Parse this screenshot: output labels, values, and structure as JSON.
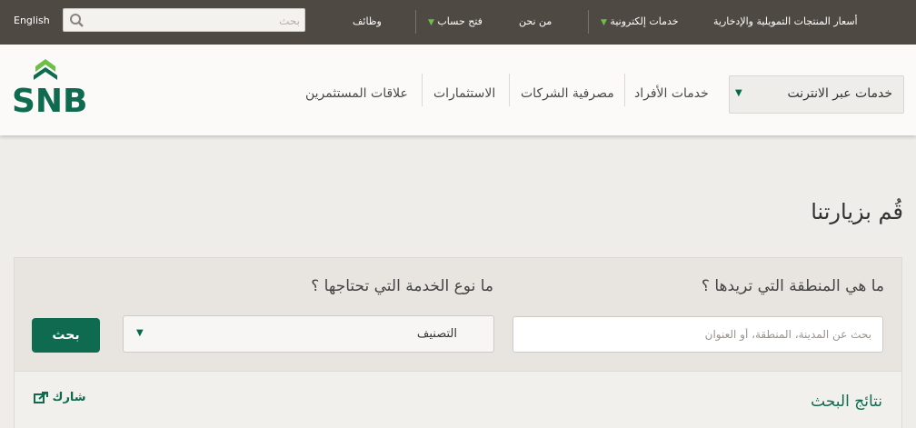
{
  "topbar": {
    "english_label": "English",
    "search_placeholder": "بحث",
    "jobs": "وظائف",
    "open_account": "فتح حساب",
    "about_us": "من نحن",
    "eservices": "خدمات إلكترونية",
    "prices": "أسعار المنتجات التمويلية والإدخارية"
  },
  "brand": {
    "logo_text": "SNB",
    "color": "#0f6b4f",
    "accent": "#6cc04a"
  },
  "nav": {
    "online_services": "خدمات عبر الانترنت",
    "personal": "خدمات الأفراد",
    "corporate": "مصرفية الشركات",
    "investments": "الاستثمارات",
    "investor_relations": "علاقات المستثمرين"
  },
  "main": {
    "title": "قُم بزيارتنا",
    "region_question": "ما هي المنطقة التي تريدها ؟",
    "service_question": "ما نوع الخدمة التي تحتاجها ؟",
    "location_placeholder": "بحث عن المدينة، المنطقة، أو العنوان",
    "category_value": "التصنيف",
    "search_button": "بحث",
    "results_title": "نتائج البحث",
    "share_label": "شارك"
  },
  "icons": [
    "search-icon",
    "chevron-down-icon",
    "share-icon",
    "snb-logo"
  ]
}
